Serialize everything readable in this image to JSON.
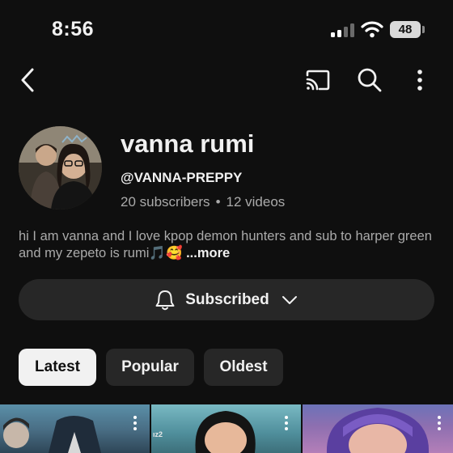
{
  "status_bar": {
    "time": "8:56",
    "battery": "48"
  },
  "header": {
    "back_icon": "chevron-left-icon",
    "cast_icon": "cast-icon",
    "search_icon": "search-icon",
    "more_icon": "vertical-dots-icon"
  },
  "channel": {
    "name": "vanna rumi",
    "handle": "@VANNA-PREPPY",
    "subscribers": "20 subscribers",
    "separator": "•",
    "videos": "12 videos",
    "bio": "hi I am vanna and I love kpop demon hunters and sub to harper green and my zepeto is rumi🎵🥰",
    "bio_more": "...more"
  },
  "subscribe": {
    "label": "Subscribed",
    "bell_icon": "bell-icon",
    "chevron_icon": "chevron-down-icon"
  },
  "chips": [
    {
      "label": "Latest",
      "selected": true
    },
    {
      "label": "Popular",
      "selected": false
    },
    {
      "label": "Oldest",
      "selected": false
    }
  ],
  "thumbnails": [
    {
      "menu_icon": "vertical-dots-icon",
      "caption": ""
    },
    {
      "menu_icon": "vertical-dots-icon",
      "caption": "ız2"
    },
    {
      "menu_icon": "vertical-dots-icon",
      "caption": ""
    }
  ],
  "colors": {
    "background": "#0f0f0f",
    "chip_selected": "#f1f1f1",
    "chip_default": "#272727",
    "text_primary": "#f1f1f1",
    "text_secondary": "#aaaaaa"
  }
}
